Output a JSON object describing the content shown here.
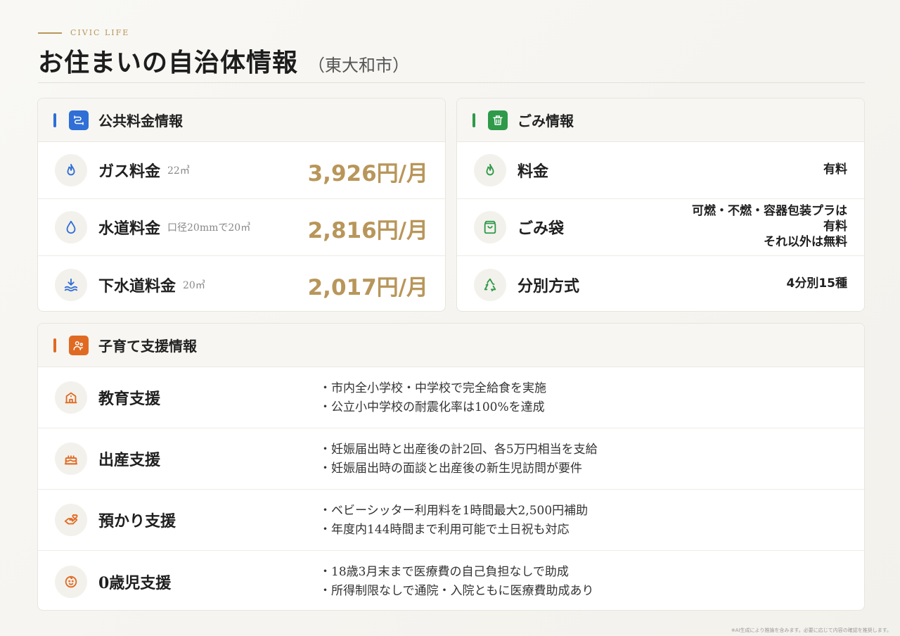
{
  "header": {
    "kicker": "CIVIC LIFE",
    "title": "お住まいの自治体情報",
    "subtitle": "（東大和市）"
  },
  "colors": {
    "gold": "#b8965a",
    "blue": "#2f6fd6",
    "green": "#2e9a4a",
    "orange": "#e06a22"
  },
  "utilities": {
    "title": "公共料金情報",
    "icon": "pipe-icon",
    "rows": [
      {
        "label": "ガス料金",
        "note": "22㎥",
        "value": "3,926円/月",
        "icon": "flame-icon"
      },
      {
        "label": "水道料金",
        "note": "口径20mmで20㎥",
        "value": "2,816円/月",
        "icon": "water-drop-icon"
      },
      {
        "label": "下水道料金",
        "note": "20㎥",
        "value": "2,017円/月",
        "icon": "sewer-icon"
      }
    ]
  },
  "garbage": {
    "title": "ごみ情報",
    "icon": "trash-icon",
    "rows": [
      {
        "label": "料金",
        "value": "有料",
        "icon": "flame-icon"
      },
      {
        "label": "ごみ袋",
        "value_lines": [
          "可燃・不燃・容器包装プラは",
          "有料",
          "それ以外は無料"
        ],
        "icon": "bag-icon"
      },
      {
        "label": "分別方式",
        "value": "4分別15種",
        "icon": "recycle-icon"
      }
    ]
  },
  "childcare": {
    "title": "子育て支援情報",
    "icon": "family-icon",
    "rows": [
      {
        "label": "教育支援",
        "icon": "school-icon",
        "bullets": [
          "・市内全小学校・中学校で完全給食を実施",
          "・公立小中学校の耐震化率は100%を達成"
        ]
      },
      {
        "label": "出産支援",
        "icon": "cake-icon",
        "bullets": [
          "・妊娠届出時と出産後の計2回、各5万円相当を支給",
          "・妊娠届出時の面談と出産後の新生児訪問が要件"
        ]
      },
      {
        "label": "預かり支援",
        "icon": "hand-heart-icon",
        "bullets": [
          "・ベビーシッター利用料を1時間最大2,500円補助",
          "・年度内144時間まで利用可能で土日祝も対応"
        ]
      },
      {
        "label": "0歳児支援",
        "icon": "baby-icon",
        "bullets": [
          "・18歳3月末まで医療費の自己負担なしで助成",
          "・所得制限なしで通院・入院ともに医療費助成あり"
        ]
      }
    ]
  },
  "footnote": "※AI生成により推論を含みます。必要に応じて内容の確認を推奨します。"
}
